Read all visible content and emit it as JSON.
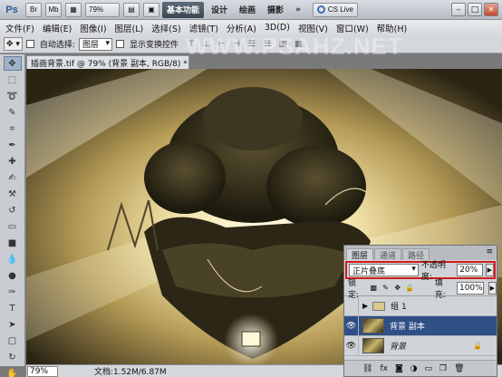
{
  "titlebar": {
    "logo": "Ps",
    "br_label": "Br",
    "mb_label": "Mb",
    "zoom": "79%",
    "workspaces": [
      "基本功能",
      "设计",
      "绘画",
      "摄影"
    ],
    "more": "»",
    "cslive": "CS Live",
    "win_min": "–",
    "win_max": "□",
    "win_close": "×"
  },
  "menu": [
    "文件(F)",
    "编辑(E)",
    "图像(I)",
    "图层(L)",
    "选择(S)",
    "滤镜(T)",
    "分析(A)",
    "3D(D)",
    "视图(V)",
    "窗口(W)",
    "帮助(H)"
  ],
  "options": {
    "auto_select": "自动选择:",
    "auto_select_value": "图层",
    "show_transform": "显示变换控件"
  },
  "watermark": "WWW.PSAHZ.NET",
  "document": {
    "tab": "插画背景.tif @ 79% (背景 副本, RGB/8) *",
    "tab_close": "×"
  },
  "status": {
    "zoom": "79%",
    "doc_info": "文档:1.52M/6.87M"
  },
  "layers_panel": {
    "tabs": [
      "图层",
      "通道",
      "路径"
    ],
    "menu_icon": "≡",
    "blend_mode": "正片叠底",
    "opacity_label": "不透明度:",
    "opacity_value": "20%",
    "lock_label": "锁定:",
    "fill_label": "填充:",
    "fill_value": "100%",
    "layers": [
      {
        "name": "组 1",
        "type": "group",
        "visible": false
      },
      {
        "name": "背景 副本",
        "type": "layer",
        "visible": true,
        "selected": true
      },
      {
        "name": "背景",
        "type": "background",
        "visible": true,
        "locked": true
      }
    ],
    "footer_icons": [
      "link-icon",
      "fx-icon",
      "mask-icon",
      "adjustment-icon",
      "folder-icon",
      "new-layer-icon",
      "trash-icon"
    ]
  },
  "colors": {
    "selected_layer": "#2f4f87",
    "highlight_border": "#d21c1c",
    "active_workspace": "#3b4550"
  }
}
